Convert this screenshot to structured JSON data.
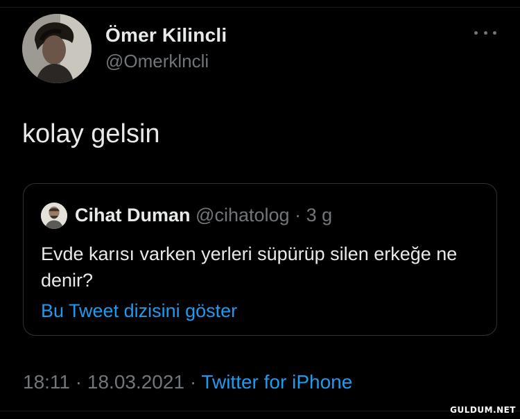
{
  "tweet": {
    "author": {
      "display_name": "Ömer Kilincli",
      "handle": "@Omerklncli"
    },
    "text": "kolay gelsin",
    "quoted": {
      "display_name": "Cihat Duman",
      "handle": "@cihatolog",
      "separator": "·",
      "time": "3 g",
      "text": "Evde karısı varken yerleri süpürüp silen erkeğe ne denir?",
      "thread_link": "Bu Tweet dizisini göster"
    },
    "meta": {
      "time": "18:11",
      "date": "18.03.2021",
      "separator": "·",
      "source": "Twitter for iPhone"
    }
  },
  "icons": {
    "more": "more-horizontal-icon"
  },
  "colors": {
    "background": "#000000",
    "text": "#e7e9ea",
    "muted": "#71767b",
    "link": "#1d9bf0",
    "border": "#2f3336"
  },
  "watermark": "GULDUM.NET"
}
